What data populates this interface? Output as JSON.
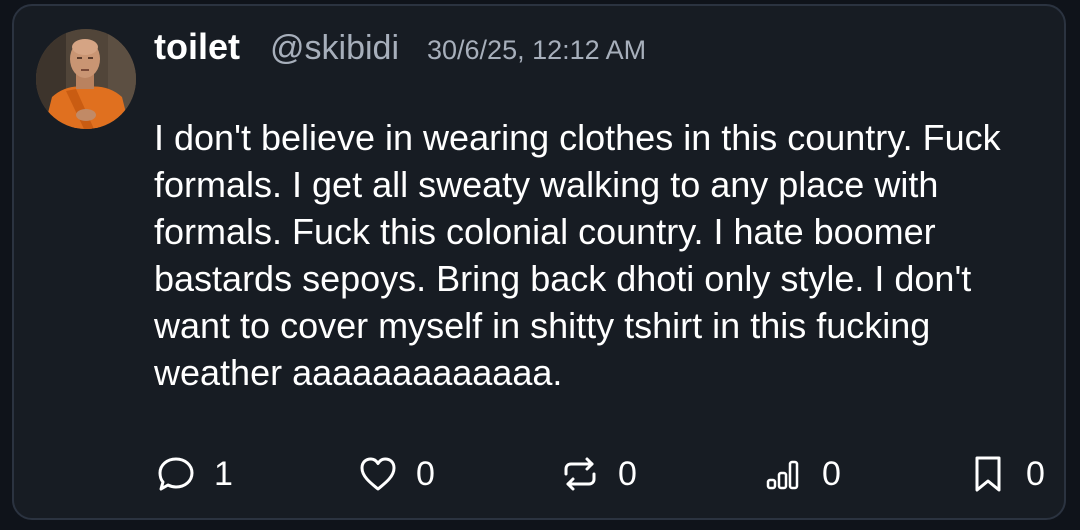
{
  "post": {
    "display_name": "toilet",
    "handle": "@skibidi",
    "timestamp": "30/6/25, 12:12 AM",
    "avatar_icon": "monk-photo-avatar",
    "text": "I don't believe in wearing clothes in this country. Fuck formals. I get all sweaty walking to any place with formals. Fuck this colonial country. I hate boomer bastards sepoys. Bring back dhoti only style. I don't want to cover myself in shitty tshirt in this fucking weather aaaaaaaaaaaaa."
  },
  "actions": {
    "reply": {
      "icon": "reply-icon",
      "count": "1"
    },
    "like": {
      "icon": "heart-icon",
      "count": "0"
    },
    "repost": {
      "icon": "repost-icon",
      "count": "0"
    },
    "views": {
      "icon": "views-icon",
      "count": "0"
    },
    "bookmark": {
      "icon": "bookmark-icon",
      "count": "0"
    }
  },
  "colors": {
    "page_background": "#0f131a",
    "card_background": "#171c23",
    "card_border": "#2b3340",
    "text_primary": "#ffffff",
    "text_secondary": "#a7afbb",
    "avatar_robe": "#e0701f"
  }
}
